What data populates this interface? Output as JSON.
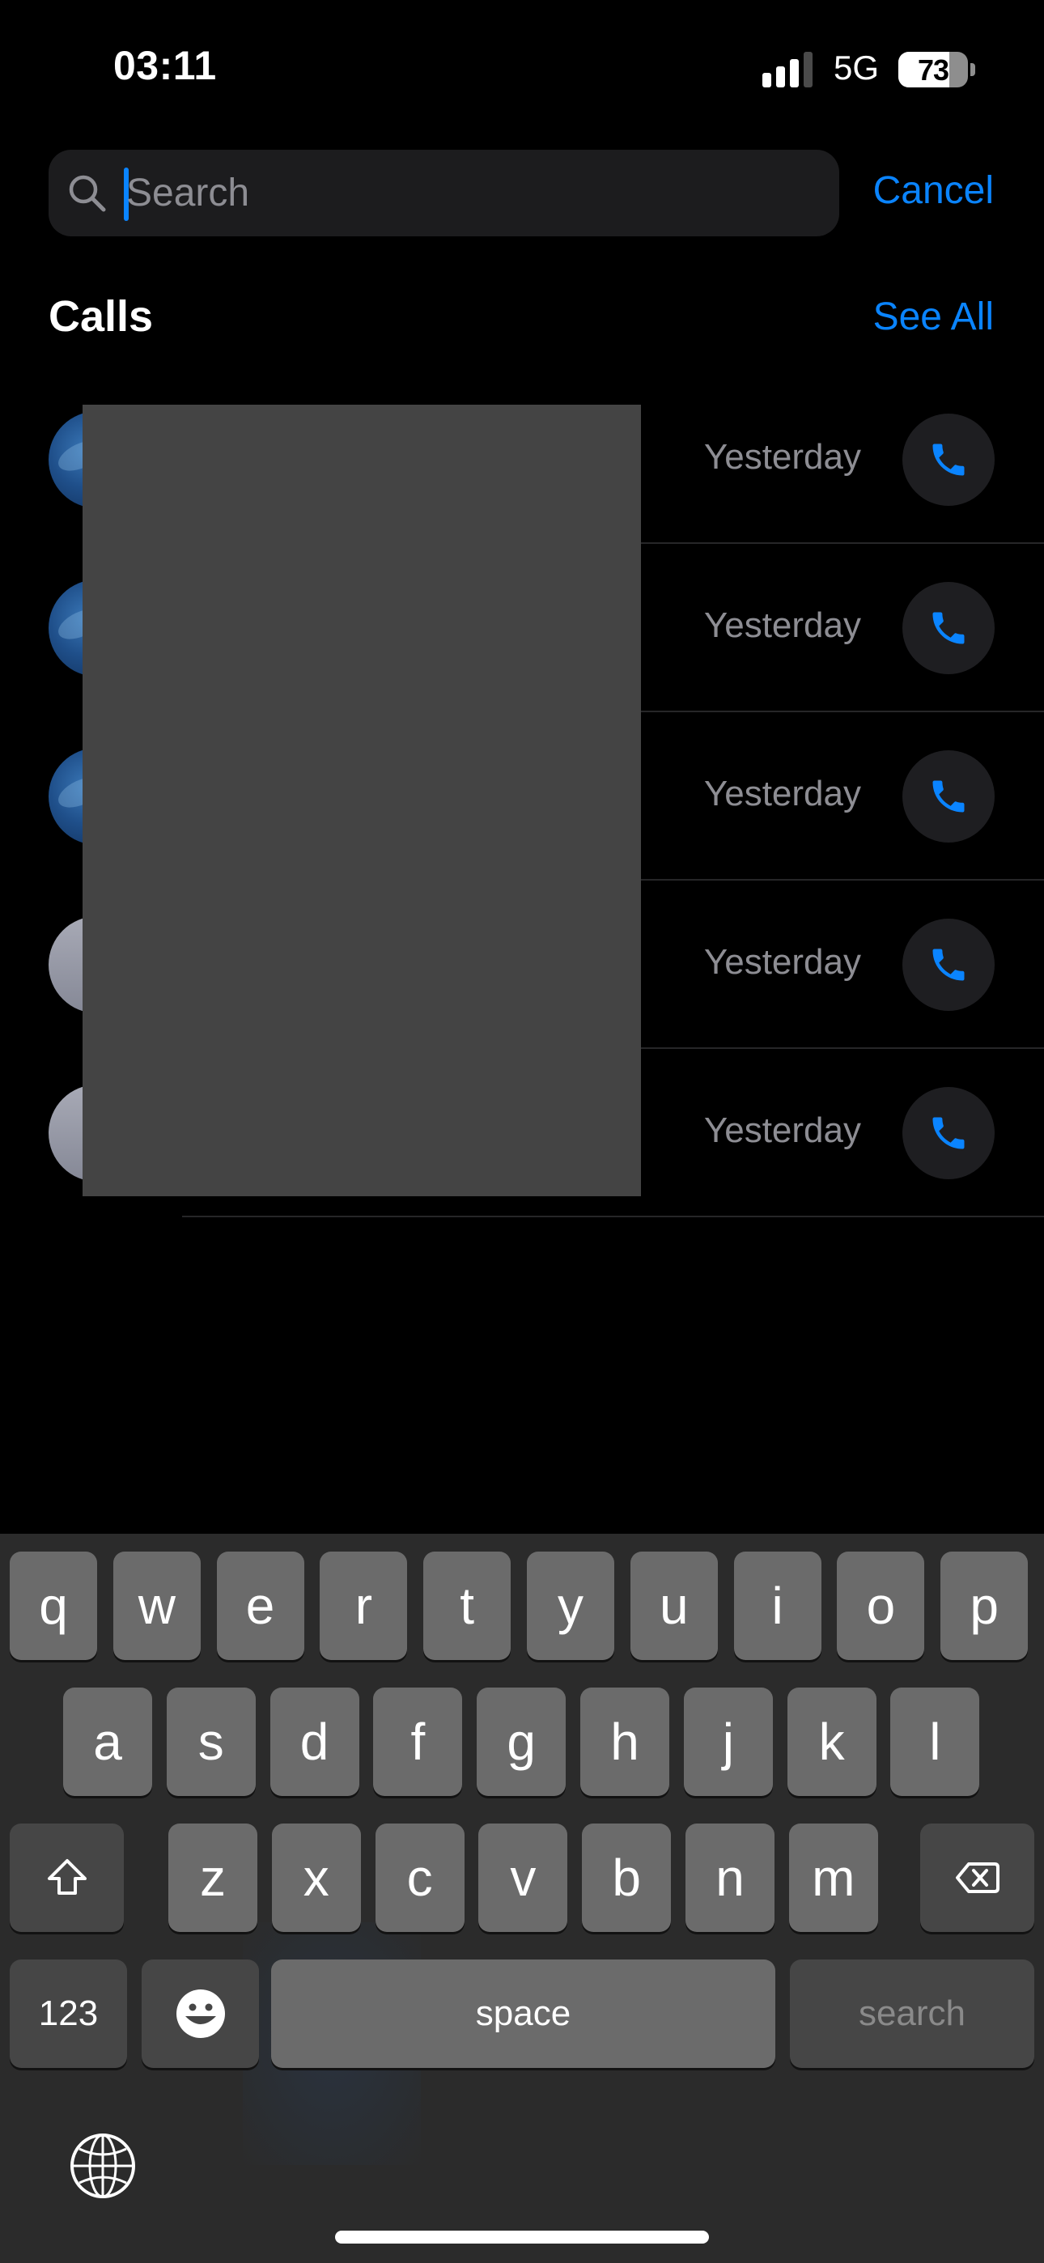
{
  "status_bar": {
    "time": "03:11",
    "network": "5G",
    "signal_bars_active": 3,
    "signal_bars_total": 4,
    "battery_percent": 73
  },
  "search": {
    "placeholder": "Search",
    "value": "",
    "icon": "magnifying-glass-icon",
    "cancel_label": "Cancel"
  },
  "calls_section": {
    "title": "Calls",
    "see_all_label": "See All",
    "items": [
      {
        "avatar": "earth-photo",
        "name": "",
        "time": "Yesterday",
        "action_icon": "phone-icon"
      },
      {
        "avatar": "earth-photo",
        "name": "",
        "time": "Yesterday",
        "action_icon": "phone-icon"
      },
      {
        "avatar": "earth-photo",
        "name": "",
        "time": "Yesterday",
        "action_icon": "phone-icon"
      },
      {
        "avatar": "default-silhouette",
        "name": "",
        "time": "Yesterday",
        "action_icon": "phone-icon"
      },
      {
        "avatar": "default-silhouette",
        "name": "",
        "time": "Yesterday",
        "action_icon": "phone-icon"
      }
    ]
  },
  "keyboard": {
    "row1": [
      "q",
      "w",
      "e",
      "r",
      "t",
      "y",
      "u",
      "i",
      "o",
      "p"
    ],
    "row2": [
      "a",
      "s",
      "d",
      "f",
      "g",
      "h",
      "j",
      "k",
      "l"
    ],
    "row3": [
      "z",
      "x",
      "c",
      "v",
      "b",
      "n",
      "m"
    ],
    "shift_icon": "shift-arrow-icon",
    "delete_icon": "backspace-icon",
    "numbers_label": "123",
    "emoji_icon": "emoji-smile-icon",
    "space_label": "space",
    "return_label": "search",
    "globe_icon": "globe-icon"
  },
  "colors": {
    "accent": "#0a84ff",
    "background": "#000000",
    "search_field": "#1c1c1e",
    "secondary_text": "#8d8d93",
    "keyboard_bg": "#2b2b2b",
    "key_bg": "#6b6b6b",
    "func_key_bg": "#464646"
  }
}
